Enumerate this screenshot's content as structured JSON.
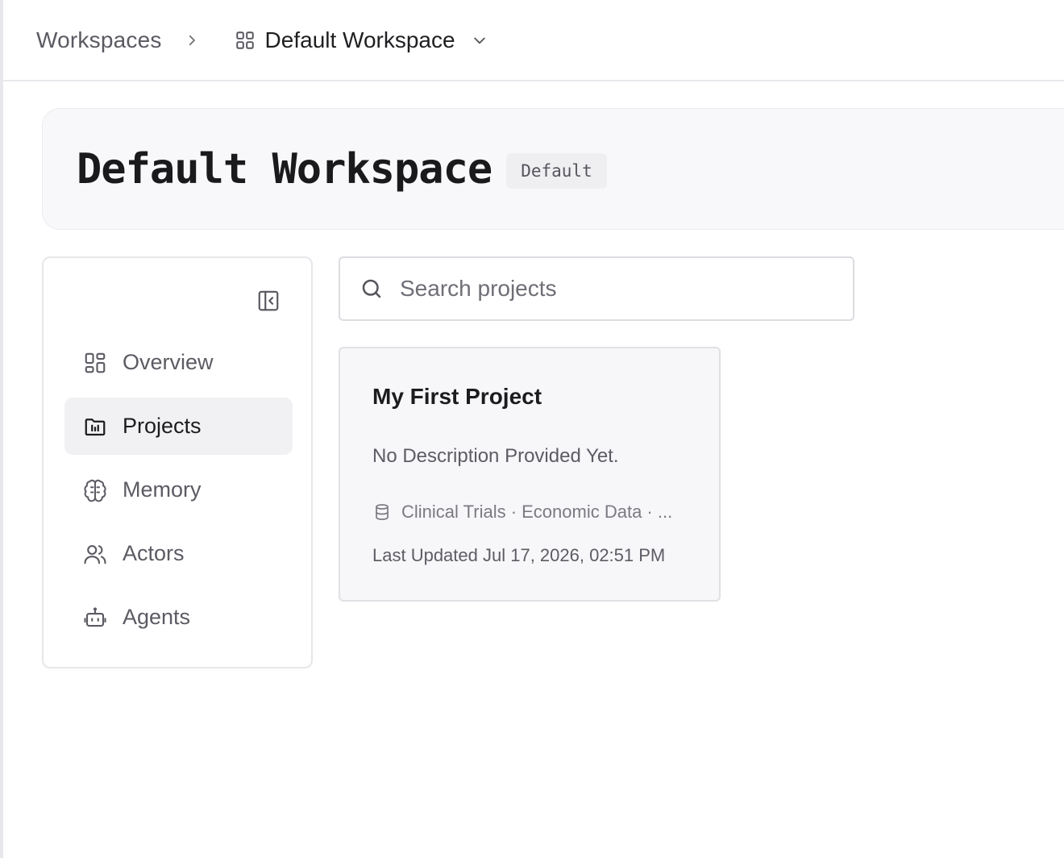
{
  "breadcrumb": {
    "root": "Workspaces",
    "current": "Default Workspace"
  },
  "header": {
    "title": "Default Workspace",
    "badge": "Default"
  },
  "sidebar": {
    "items": [
      {
        "label": "Overview",
        "icon": "grid-icon",
        "active": false
      },
      {
        "label": "Projects",
        "icon": "folder-icon",
        "active": true
      },
      {
        "label": "Memory",
        "icon": "brain-icon",
        "active": false
      },
      {
        "label": "Actors",
        "icon": "users-icon",
        "active": false
      },
      {
        "label": "Agents",
        "icon": "robot-icon",
        "active": false
      }
    ]
  },
  "search": {
    "placeholder": "Search projects",
    "value": ""
  },
  "projects": [
    {
      "title": "My First Project",
      "description": "No Description Provided Yet.",
      "sources": "Clinical Trials · Economic Data · ...",
      "updated": "Last Updated Jul 17, 2026, 02:51 PM"
    }
  ],
  "colors": {
    "accent_bg": "#f1f1f3",
    "card_bg": "#f7f7f9",
    "header_bg": "#f8f8fa",
    "border": "#e7e7eb"
  }
}
